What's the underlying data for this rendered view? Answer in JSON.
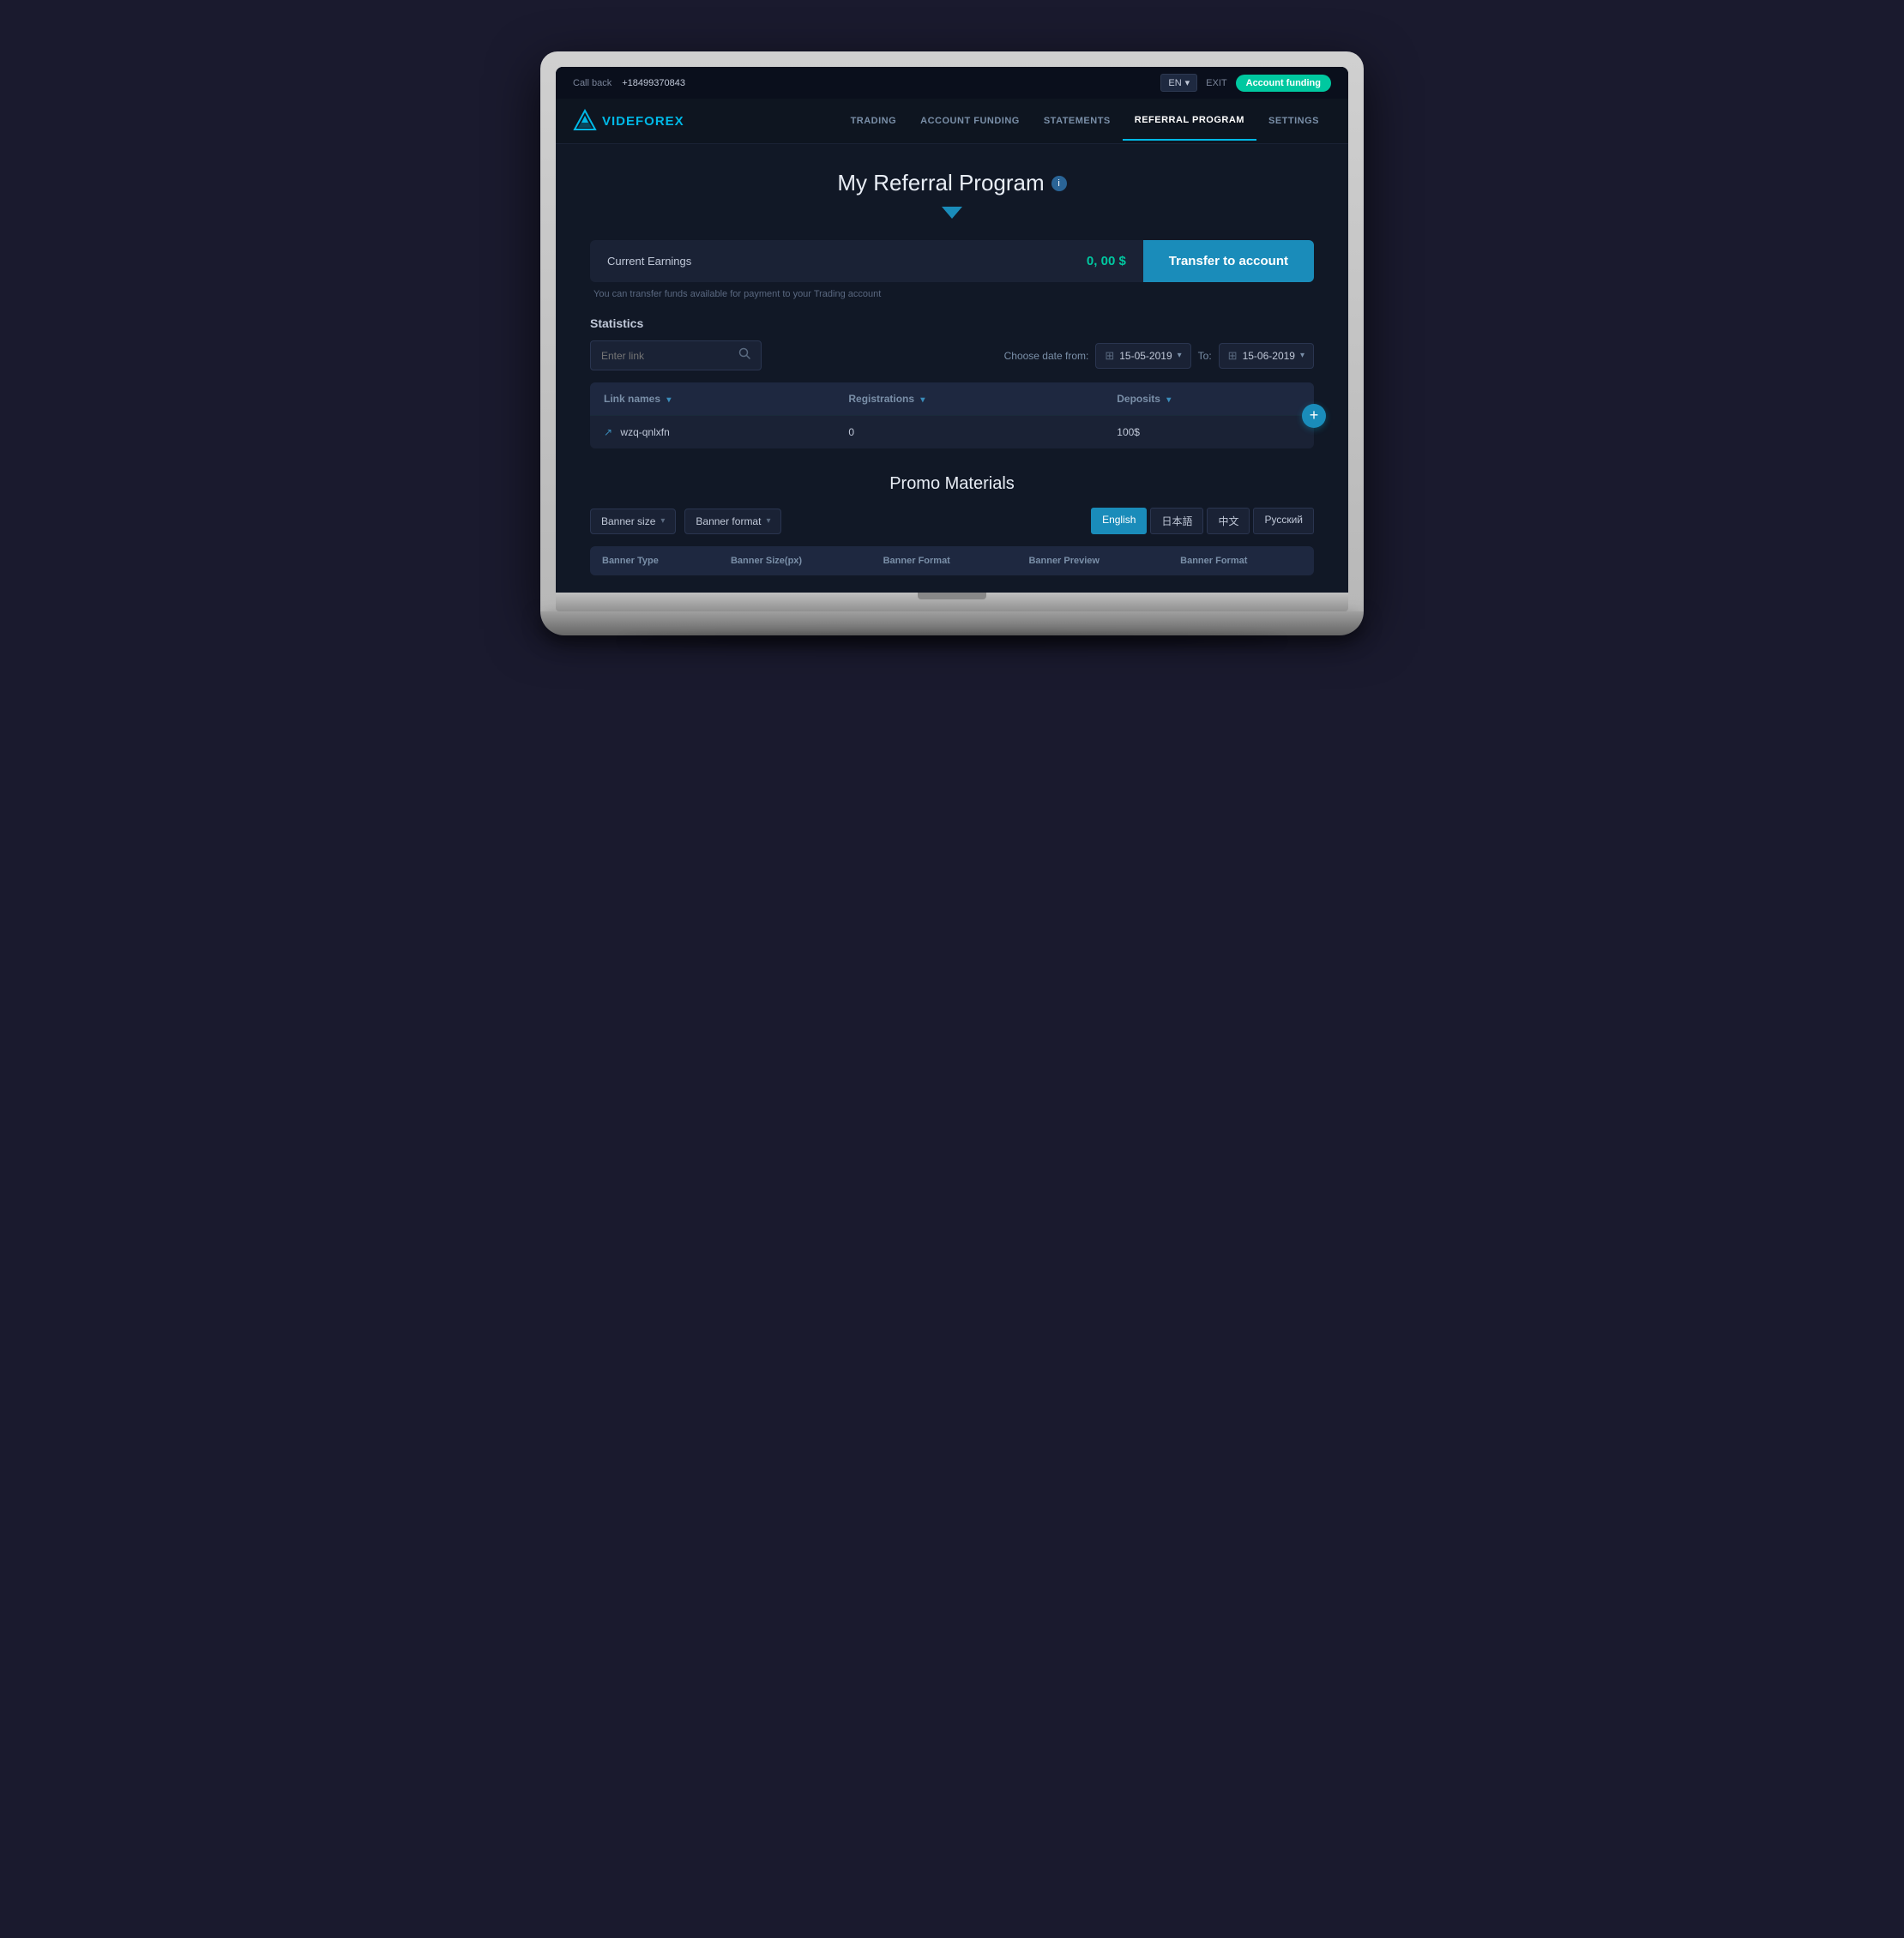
{
  "topbar": {
    "callback_label": "Call back",
    "phone": "+18499370843",
    "lang": "EN",
    "lang_arrow": "▾",
    "exit": "EXIT",
    "account_funding_btn": "Account funding"
  },
  "nav": {
    "logo_text_1": "VIDE",
    "logo_text_2": "FOREX",
    "items": [
      {
        "label": "TRADING",
        "active": false
      },
      {
        "label": "ACCOUNT FUNDING",
        "active": false
      },
      {
        "label": "STATEMENTS",
        "active": false
      },
      {
        "label": "REFERRAL PROGRAM",
        "active": true
      },
      {
        "label": "SETTINGS",
        "active": false
      }
    ]
  },
  "hero": {
    "title": "My Referral Program",
    "info_icon": "i"
  },
  "earnings": {
    "label": "Current Earnings",
    "value": "0, 00 $",
    "transfer_btn": "Transfer to account",
    "note": "You can transfer funds available for payment to your Trading account"
  },
  "statistics": {
    "section_title": "Statistics",
    "search_placeholder": "Enter link",
    "date_label_from": "Choose date from:",
    "date_from": "15-05-2019",
    "date_to_label": "To:",
    "date_to": "15-06-2019",
    "table": {
      "headers": [
        "Link names",
        "Registrations",
        "Deposits"
      ],
      "rows": [
        {
          "link": "wzq-qnlxfn",
          "registrations": "0",
          "deposits": "100$"
        }
      ]
    },
    "add_btn": "+"
  },
  "promo": {
    "title": "Promo Materials",
    "filter1": "Banner size",
    "filter2": "Banner format",
    "lang_tabs": [
      "English",
      "日本語",
      "中文",
      "Русский"
    ],
    "active_lang": "English",
    "table_headers": [
      "Banner Type",
      "Banner Size(px)",
      "Banner Format",
      "Banner Preview",
      "Banner Format"
    ]
  }
}
